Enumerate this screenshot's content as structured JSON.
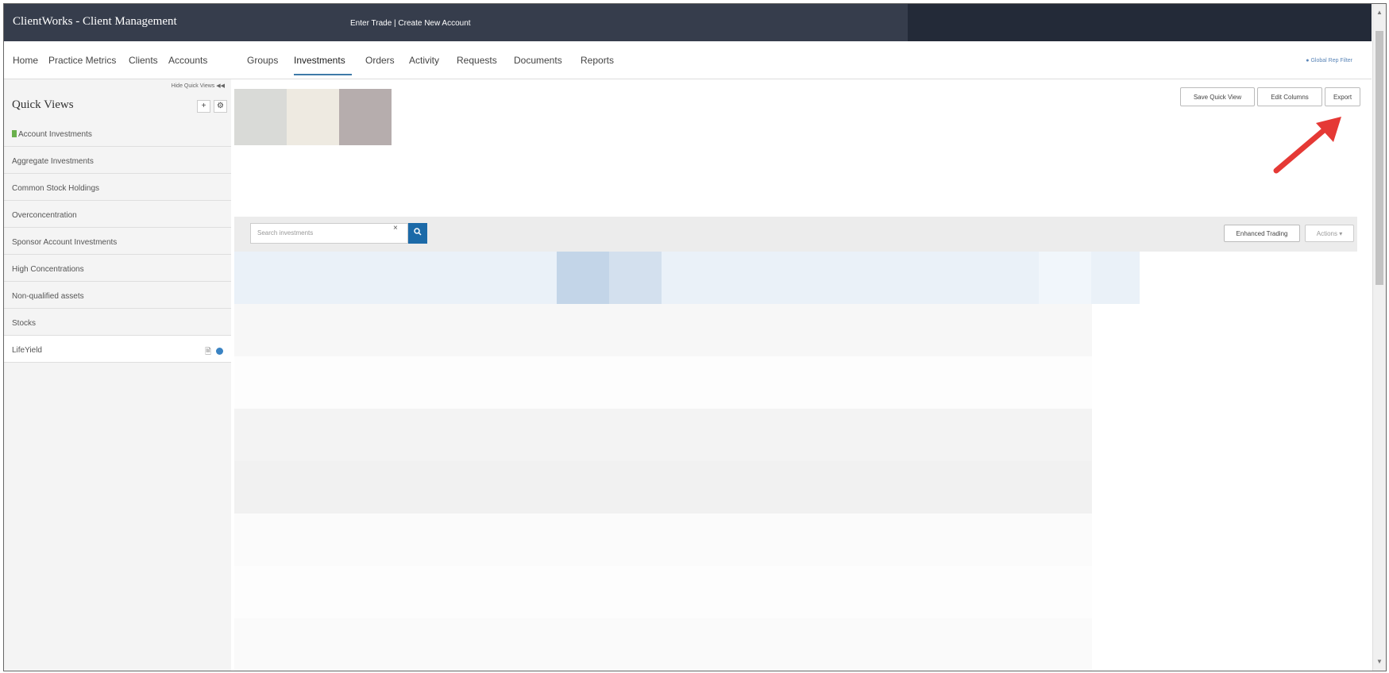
{
  "app": {
    "title": "ClientWorks - Client Management",
    "top_links": "Enter Trade | Create New Account"
  },
  "nav": {
    "items": [
      "Home",
      "Practice Metrics",
      "Clients",
      "Accounts",
      "Groups",
      "Investments",
      "Orders",
      "Activity",
      "Requests",
      "Documents",
      "Reports"
    ],
    "active": "Investments",
    "global_filter": "● Global Rep Filter"
  },
  "sidebar": {
    "hide_link": "Hide Quick Views ◀◀",
    "title": "Quick Views",
    "add_label": "+",
    "settings_label": "⚙",
    "items": [
      {
        "label": "Account Investments",
        "default": true
      },
      {
        "label": "Aggregate Investments"
      },
      {
        "label": "Common Stock Holdings"
      },
      {
        "label": "Overconcentration"
      },
      {
        "label": "Sponsor Account Investments"
      },
      {
        "label": "High Concentrations"
      },
      {
        "label": "Non-qualified assets"
      },
      {
        "label": "Stocks"
      },
      {
        "label": "LifeYield",
        "selected": true
      }
    ]
  },
  "toolbar": {
    "save_quick_view": "Save Quick View",
    "edit_columns": "Edit Columns",
    "export": "Export"
  },
  "search": {
    "placeholder": "Search investments",
    "clear": "×",
    "button_icon": "🔍"
  },
  "actions": {
    "enhanced_trading": "Enhanced Trading",
    "actions": "Actions ▾"
  },
  "colors": {
    "topbar": "#363d4c",
    "accent": "#1c6aa8",
    "annotation_arrow": "#e53935",
    "default_flag": "#6ab04c"
  }
}
